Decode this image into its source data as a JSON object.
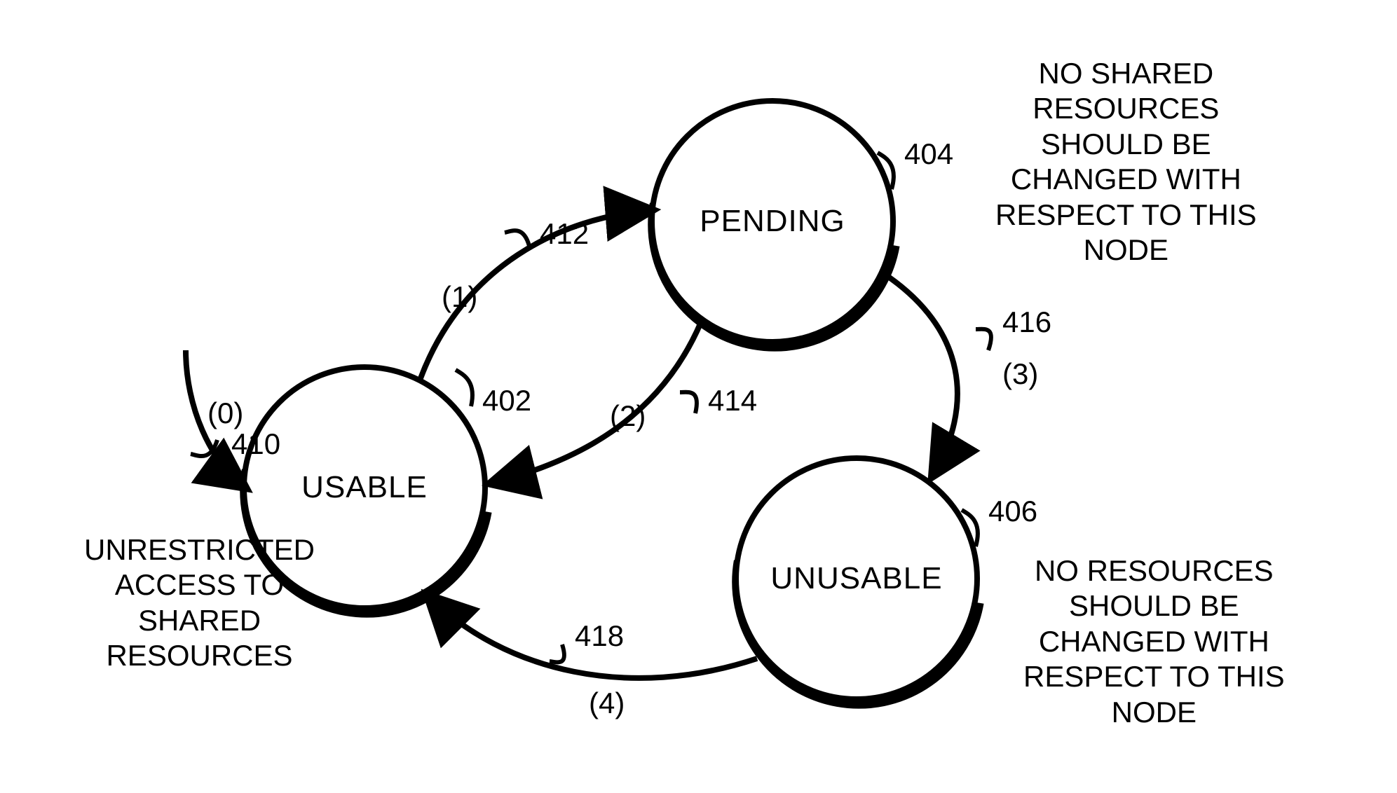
{
  "chart_data": {
    "type": "diagram",
    "title": "",
    "nodes": [
      {
        "id": "usable",
        "label": "USABLE",
        "ref": "402",
        "desc": "UNRESTRICTED\nACCESS TO\nSHARED\nRESOURCES"
      },
      {
        "id": "pending",
        "label": "PENDING",
        "ref": "404",
        "desc": "NO SHARED\nRESOURCES\nSHOULD BE\nCHANGED WITH\nRESPECT TO THIS\nNODE"
      },
      {
        "id": "unusable",
        "label": "UNUSABLE",
        "ref": "406",
        "desc": "NO RESOURCES\nSHOULD BE\nCHANGED WITH\nRESPECT TO THIS\nNODE"
      }
    ],
    "edges": [
      {
        "id": "e0",
        "from": "start",
        "to": "usable",
        "ref": "410",
        "label": "(0)"
      },
      {
        "id": "e1",
        "from": "usable",
        "to": "pending",
        "ref": "412",
        "label": "(1)"
      },
      {
        "id": "e2",
        "from": "pending",
        "to": "usable",
        "ref": "414",
        "label": "(2)"
      },
      {
        "id": "e3",
        "from": "pending",
        "to": "unusable",
        "ref": "416",
        "label": "(3)"
      },
      {
        "id": "e4",
        "from": "unusable",
        "to": "usable",
        "ref": "418",
        "label": "(4)"
      }
    ]
  }
}
